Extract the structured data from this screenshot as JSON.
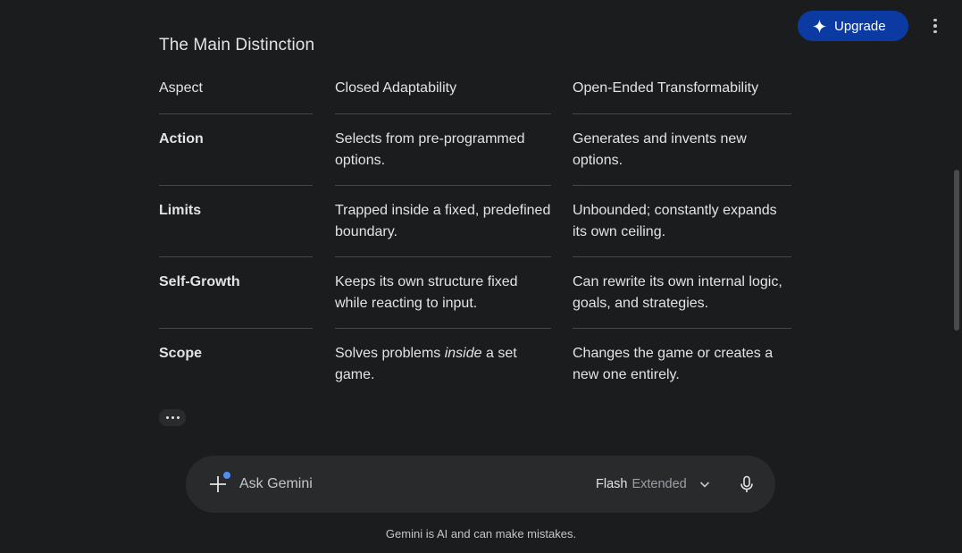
{
  "header": {
    "upgrade_label": "Upgrade",
    "upgrade_icon": "sparkle-icon",
    "menu_icon": "more-vert-icon"
  },
  "section": {
    "title": "The Main Distinction"
  },
  "table": {
    "columns": [
      "Aspect",
      "Closed Adaptability",
      "Open-Ended Transformability"
    ],
    "rows": [
      {
        "aspect": "Action",
        "closed": "Selects from pre-programmed options.",
        "open": "Generates and invents new options."
      },
      {
        "aspect": "Limits",
        "closed": "Trapped inside a fixed, predefined boundary.",
        "open": "Unbounded; constantly expands its own ceiling."
      },
      {
        "aspect": "Self-Growth",
        "closed": "Keeps its own structure fixed while reacting to input.",
        "open": "Can rewrite its own internal logic, goals, and strategies."
      },
      {
        "aspect": "Scope",
        "closed_before": "Solves problems ",
        "closed_italic": "inside",
        "closed_after": " a set game.",
        "open": "Changes the game or creates a new one entirely."
      }
    ]
  },
  "more_icon": "more-horiz-icon",
  "composer": {
    "placeholder": "Ask Gemini",
    "model_name": "Flash",
    "model_mode": "Extended",
    "add_icon": "plus-icon",
    "chevron_icon": "chevron-down-icon",
    "mic_icon": "mic-icon"
  },
  "footer": {
    "disclaimer": "Gemini is AI and can make mistakes."
  },
  "colors": {
    "background": "#1b1c1d",
    "upgrade_bg": "#0b3aa3",
    "composer_bg": "#282a2c",
    "accent_dot": "#4c8df6",
    "divider": "#444746"
  }
}
